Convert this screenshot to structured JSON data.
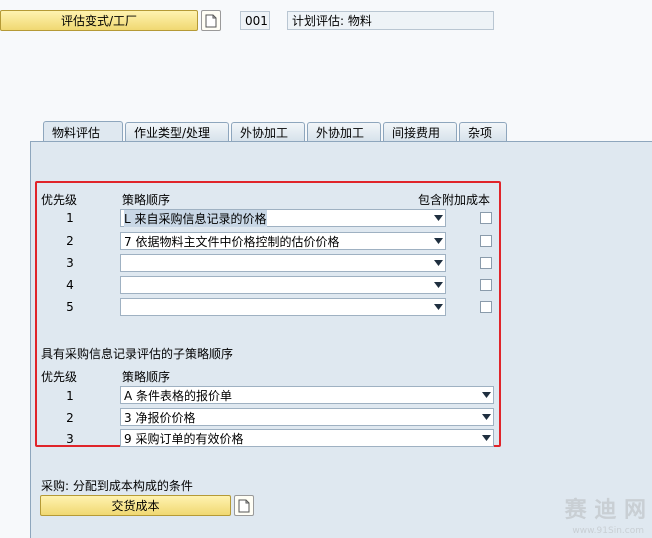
{
  "header": {
    "valuation_button": "评估变式/工厂",
    "code": "001",
    "description": "计划评估: 物料"
  },
  "tabs": [
    {
      "label": "物料评估",
      "active": true
    },
    {
      "label": "作业类型/处理",
      "active": false
    },
    {
      "label": "外协加工",
      "active": false
    },
    {
      "label": "外协加工",
      "active": false
    },
    {
      "label": "间接费用",
      "active": false
    },
    {
      "label": "杂项",
      "active": false
    }
  ],
  "strategy": {
    "priority_header": "优先级",
    "strategy_header": "策略顺序",
    "addl_cost_header": "包含附加成本",
    "rows": [
      {
        "priority": "1",
        "value": "L 来自采购信息记录的价格",
        "checked": false
      },
      {
        "priority": "2",
        "value": "7 依据物料主文件中价格控制的估价价格",
        "checked": false
      },
      {
        "priority": "3",
        "value": "",
        "checked": false
      },
      {
        "priority": "4",
        "value": "",
        "checked": false
      },
      {
        "priority": "5",
        "value": "",
        "checked": false
      }
    ]
  },
  "sub_strategy": {
    "title": "具有采购信息记录评估的子策略顺序",
    "priority_header": "优先级",
    "strategy_header": "策略顺序",
    "rows": [
      {
        "priority": "1",
        "value": "A 条件表格的报价单"
      },
      {
        "priority": "2",
        "value": "3 净报价价格"
      },
      {
        "priority": "3",
        "value": "9 采购订单的有效价格"
      }
    ]
  },
  "purchasing": {
    "label": "采购: 分配到成本构成的条件",
    "button": "交货成本"
  },
  "watermark": {
    "text": "赛 迪 网",
    "url": "www.91Sin.com"
  },
  "colors": {
    "highlight_border": "#e0242a",
    "button_yellow": "#f0d872",
    "panel_bg": "#dfe8f0"
  }
}
